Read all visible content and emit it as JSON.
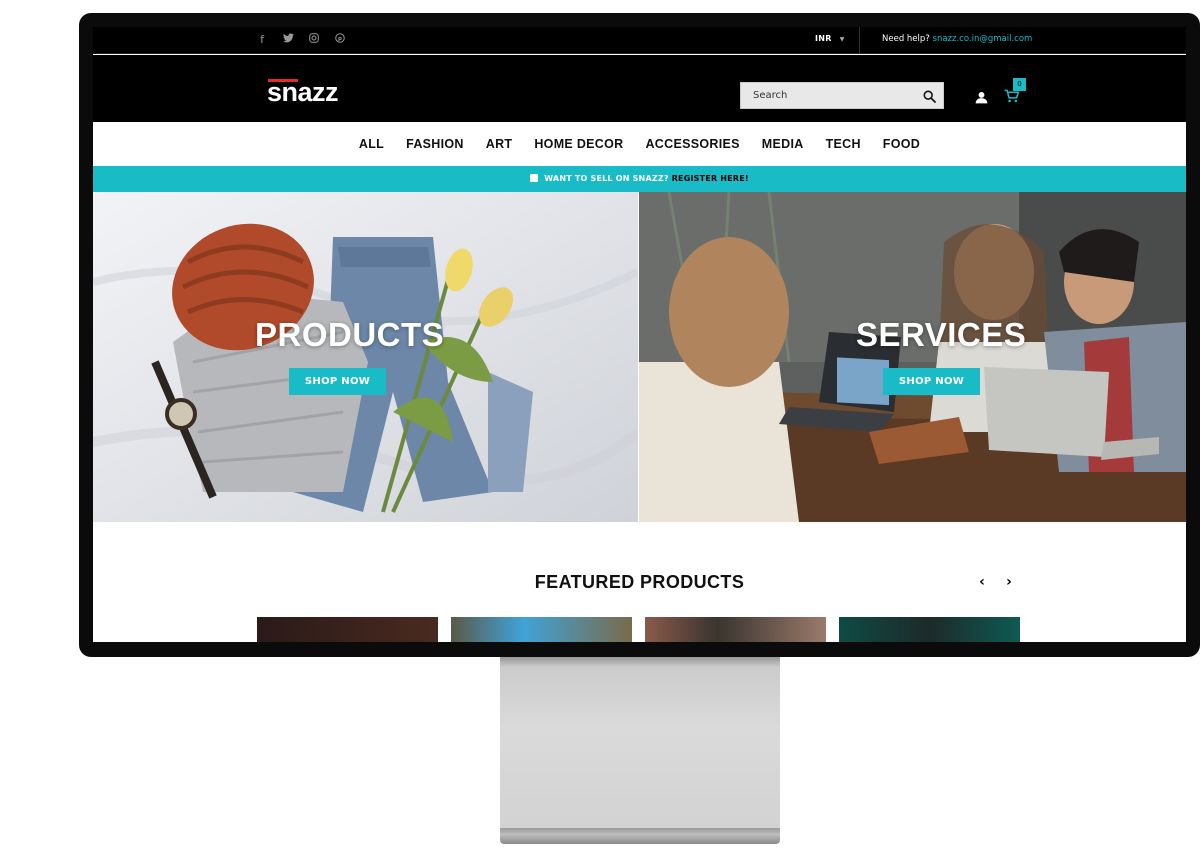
{
  "topbar": {
    "social": [
      {
        "name": "facebook-icon",
        "glyph": "f"
      },
      {
        "name": "twitter-icon",
        "glyph": "t"
      },
      {
        "name": "instagram-icon",
        "glyph": "◎"
      },
      {
        "name": "pinterest-icon",
        "glyph": "p"
      }
    ],
    "currency": "INR",
    "help_label": "Need help?",
    "help_email": "snazz.co.in@gmail.com"
  },
  "header": {
    "logo": "snazz",
    "search_placeholder": "Search",
    "cart_count": "0"
  },
  "nav": {
    "items": [
      "ALL",
      "FASHION",
      "ART",
      "HOME DECOR",
      "ACCESSORIES",
      "MEDIA",
      "TECH",
      "FOOD"
    ]
  },
  "promo": {
    "text": "WANT TO SELL ON SNAZZ?",
    "link": "REGISTER HERE!"
  },
  "hero": {
    "left": {
      "title": "PRODUCTS",
      "button": "SHOP NOW"
    },
    "right": {
      "title": "SERVICES",
      "button": "SHOP NOW"
    }
  },
  "featured": {
    "title": "FEATURED PRODUCTS",
    "prev": "‹",
    "next": "›"
  },
  "colors": {
    "accent": "#19bcc6",
    "logo_red": "#e02b2b",
    "dark": "#000000"
  }
}
